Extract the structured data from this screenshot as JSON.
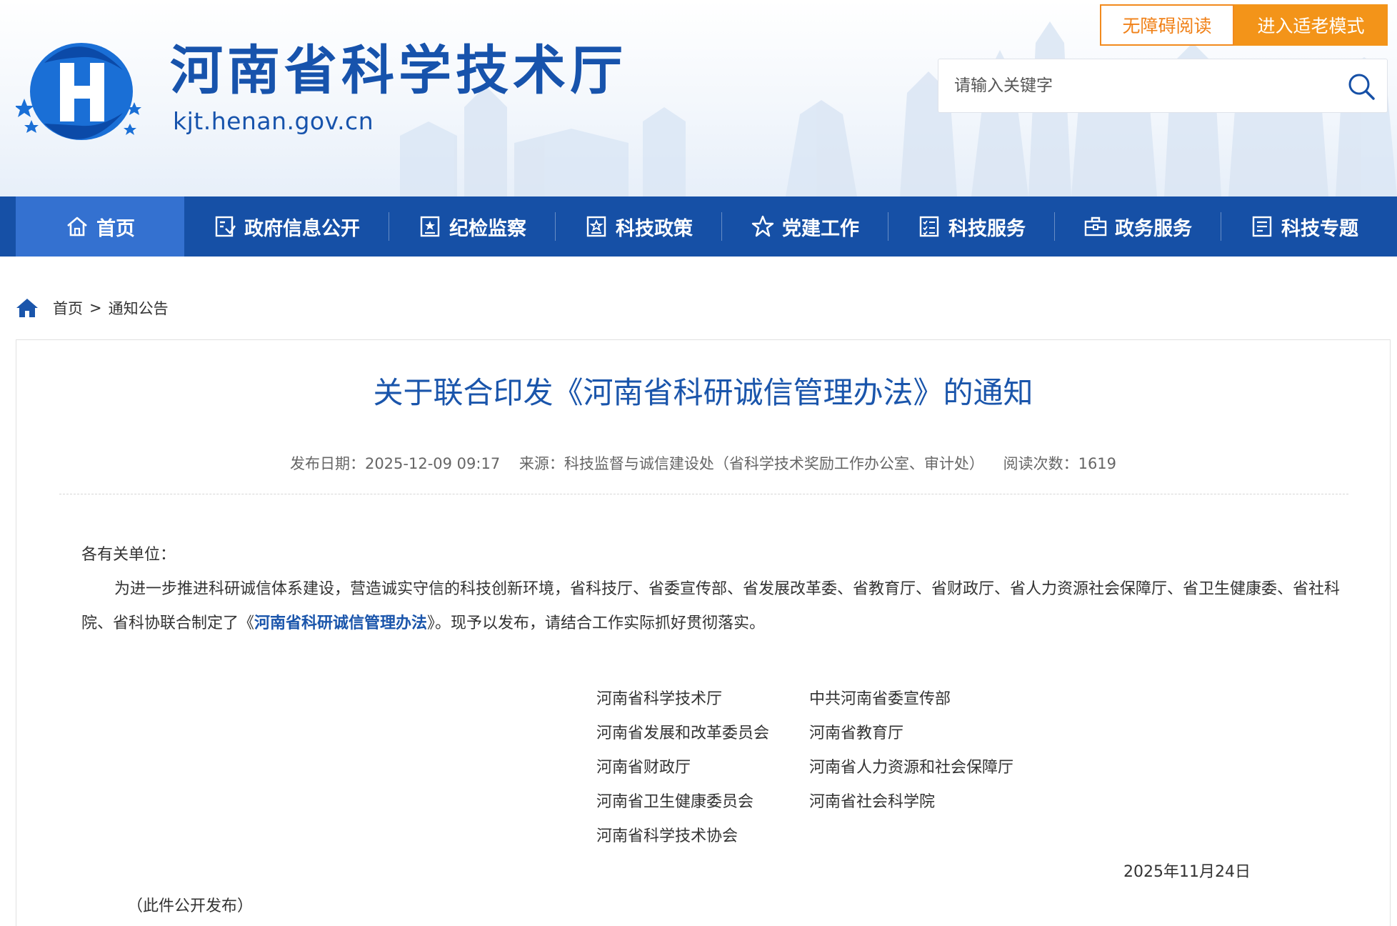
{
  "header": {
    "site_title": "河南省科学技术厅",
    "site_domain": "kjt.henan.gov.cn",
    "accessibility_label": "无障碍阅读",
    "elder_mode_label": "进入适老模式",
    "search_placeholder": "请输入关键字"
  },
  "nav": {
    "items": [
      {
        "label": "首页",
        "icon": "home-icon"
      },
      {
        "label": "政府信息公开",
        "icon": "info-disclosure-icon"
      },
      {
        "label": "纪检监察",
        "icon": "inspection-icon"
      },
      {
        "label": "科技政策",
        "icon": "policy-icon"
      },
      {
        "label": "党建工作",
        "icon": "star-icon"
      },
      {
        "label": "科技服务",
        "icon": "checklist-icon"
      },
      {
        "label": "政务服务",
        "icon": "briefcase-icon"
      },
      {
        "label": "科技专题",
        "icon": "document-icon"
      }
    ]
  },
  "breadcrumb": {
    "home": "首页",
    "separator": ">",
    "current": "通知公告"
  },
  "article": {
    "title": "关于联合印发《河南省科研诚信管理办法》的通知",
    "publish_date": "发布日期：2025-12-09 09:17",
    "source": "来源：科技监督与诚信建设处（省科学技术奖励工作办公室、审计处）",
    "views": "阅读次数：1619",
    "salutation": "各有关单位：",
    "paragraph_before_link": "为进一步推进科研诚信体系建设，营造诚实守信的科技创新环境，省科技厅、省委宣传部、省发展改革委、省教育厅、省财政厅、省人力资源社会保障厅、省卫生健康委、省社科院、省科协联合制定了《",
    "paragraph_link": "河南省科研诚信管理办法",
    "paragraph_after_link": "》。现予以发布，请结合工作实际抓好贯彻落实。",
    "signatories": [
      [
        "河南省科学技术厅",
        "中共河南省委宣传部"
      ],
      [
        "河南省发展和改革委员会",
        "河南省教育厅"
      ],
      [
        "河南省财政厅",
        "河南省人力资源和社会保障厅"
      ],
      [
        "河南省卫生健康委员会",
        "河南省社会科学院"
      ],
      [
        "河南省科学技术协会",
        ""
      ]
    ],
    "date": "2025年11月24日",
    "note": "（此件公开发布）"
  },
  "colors": {
    "brand_blue": "#1650a6",
    "nav_active": "#3471d0",
    "title_blue": "#1a55ab",
    "orange": "#f39419"
  }
}
